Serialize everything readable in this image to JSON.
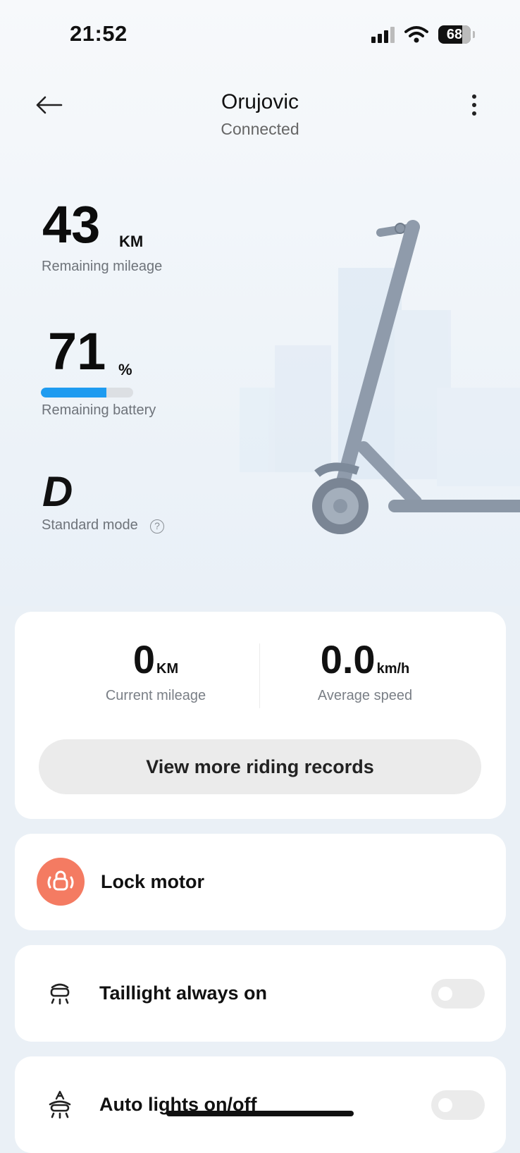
{
  "status_bar": {
    "time": "21:52",
    "battery_level": "68"
  },
  "header": {
    "title": "Orujovic",
    "subtitle": "Connected"
  },
  "stats": {
    "mileage_value": "43",
    "mileage_unit": "KM",
    "mileage_label": "Remaining mileage",
    "battery_value": "71",
    "battery_unit": "%",
    "battery_label": "Remaining battery",
    "battery_fraction": 0.71,
    "mode_letter": "D",
    "mode_label": "Standard mode",
    "help_glyph": "?"
  },
  "ride_card": {
    "current_mileage_value": "0",
    "current_mileage_unit": "KM",
    "current_mileage_label": "Current mileage",
    "average_speed_value": "0.0",
    "average_speed_unit": "km/h",
    "average_speed_label": "Average speed",
    "records_button": "View more riding records"
  },
  "controls": {
    "lock_motor": {
      "label": "Lock motor",
      "icon": "lock-motor-icon"
    },
    "taillight": {
      "label": "Taillight always on",
      "icon": "taillight-icon",
      "enabled": false
    },
    "auto_lights": {
      "label": "Auto lights on/off",
      "icon": "auto-lights-icon",
      "enabled": false
    }
  },
  "colors": {
    "battery_fill": "#1e9bf0",
    "lock_accent": "#f47b62",
    "background": "#eaf0f6"
  }
}
